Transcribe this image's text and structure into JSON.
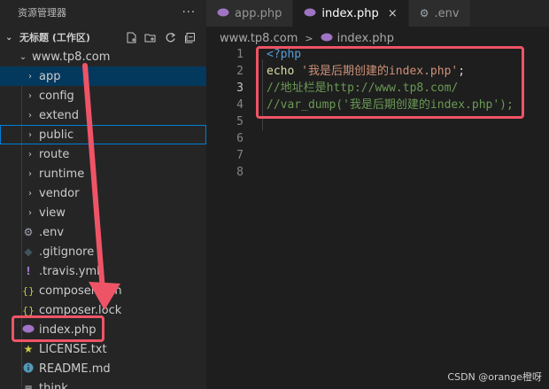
{
  "sidebar": {
    "title": "资源管理器",
    "more": "···",
    "workspace": "无标题 (工作区)",
    "root_folder": "www.tp8.com",
    "items": [
      {
        "label": "app",
        "type": "folder",
        "icon": "chevron-right-icon"
      },
      {
        "label": "config",
        "type": "folder",
        "icon": "chevron-right-icon"
      },
      {
        "label": "extend",
        "type": "folder",
        "icon": "chevron-right-icon"
      },
      {
        "label": "public",
        "type": "folder",
        "icon": "chevron-right-icon"
      },
      {
        "label": "route",
        "type": "folder",
        "icon": "chevron-right-icon"
      },
      {
        "label": "runtime",
        "type": "folder",
        "icon": "chevron-right-icon"
      },
      {
        "label": "vendor",
        "type": "folder",
        "icon": "chevron-right-icon"
      },
      {
        "label": "view",
        "type": "folder",
        "icon": "chevron-right-icon"
      },
      {
        "label": ".env",
        "type": "file",
        "icon": "gear-icon"
      },
      {
        "label": ".gitignore",
        "type": "file",
        "icon": "git-icon"
      },
      {
        "label": ".travis.yml",
        "type": "file",
        "icon": "yaml-icon"
      },
      {
        "label": "composer.json",
        "type": "file",
        "icon": "json-icon"
      },
      {
        "label": "composer.lock",
        "type": "file",
        "icon": "json-icon"
      },
      {
        "label": "index.php",
        "type": "file",
        "icon": "php-icon"
      },
      {
        "label": "LICENSE.txt",
        "type": "file",
        "icon": "license-icon"
      },
      {
        "label": "README.md",
        "type": "file",
        "icon": "info-icon"
      },
      {
        "label": "think",
        "type": "file",
        "icon": "lines-icon"
      }
    ]
  },
  "tabs": [
    {
      "label": "app.php",
      "icon": "php-icon",
      "active": false
    },
    {
      "label": "index.php",
      "icon": "php-icon",
      "active": true,
      "close": "×"
    },
    {
      "label": ".env",
      "icon": "gear-icon",
      "active": false
    }
  ],
  "breadcrumb": {
    "folder": "www.tp8.com",
    "separator": ">",
    "file": "index.php"
  },
  "editor": {
    "line_numbers": [
      "1",
      "2",
      "3",
      "4",
      "5",
      "6",
      "7",
      "8"
    ],
    "current_line": "3",
    "lines": [
      [
        {
          "t": "<?php",
          "c": "kw"
        }
      ],
      [
        {
          "t": "echo ",
          "c": "fn"
        },
        {
          "t": "'我是后期创建的index.php'",
          "c": "str"
        },
        {
          "t": ";",
          "c": "plain"
        }
      ],
      [
        {
          "t": "//地址栏是http://www.tp8.com/",
          "c": "cm"
        }
      ],
      [
        {
          "t": "//var_dump('我是后期创建的index.php');",
          "c": "cm"
        }
      ],
      [],
      [],
      [],
      []
    ]
  },
  "watermark": "CSDN @orange橙呀",
  "colors": {
    "annotation": "#ef5466",
    "selected_row": "#04395e",
    "focus_border": "#007fd4"
  }
}
